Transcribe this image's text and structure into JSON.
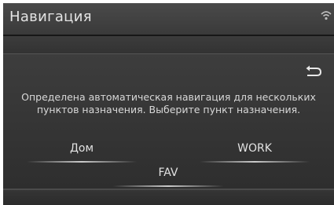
{
  "header": {
    "title": "Навигация",
    "wifi_icon": "wifi-icon"
  },
  "dialog": {
    "back_icon": "back-arrow-icon",
    "message": "Определена автоматическая навигация для нескольких пунктов назначения. Выберите пункт назначения.",
    "options": [
      {
        "label": "Дом"
      },
      {
        "label": "WORK"
      },
      {
        "label": "FAV"
      }
    ]
  },
  "colors": {
    "background": "#171717",
    "header": "#444444",
    "text": "#e2e2e2"
  }
}
